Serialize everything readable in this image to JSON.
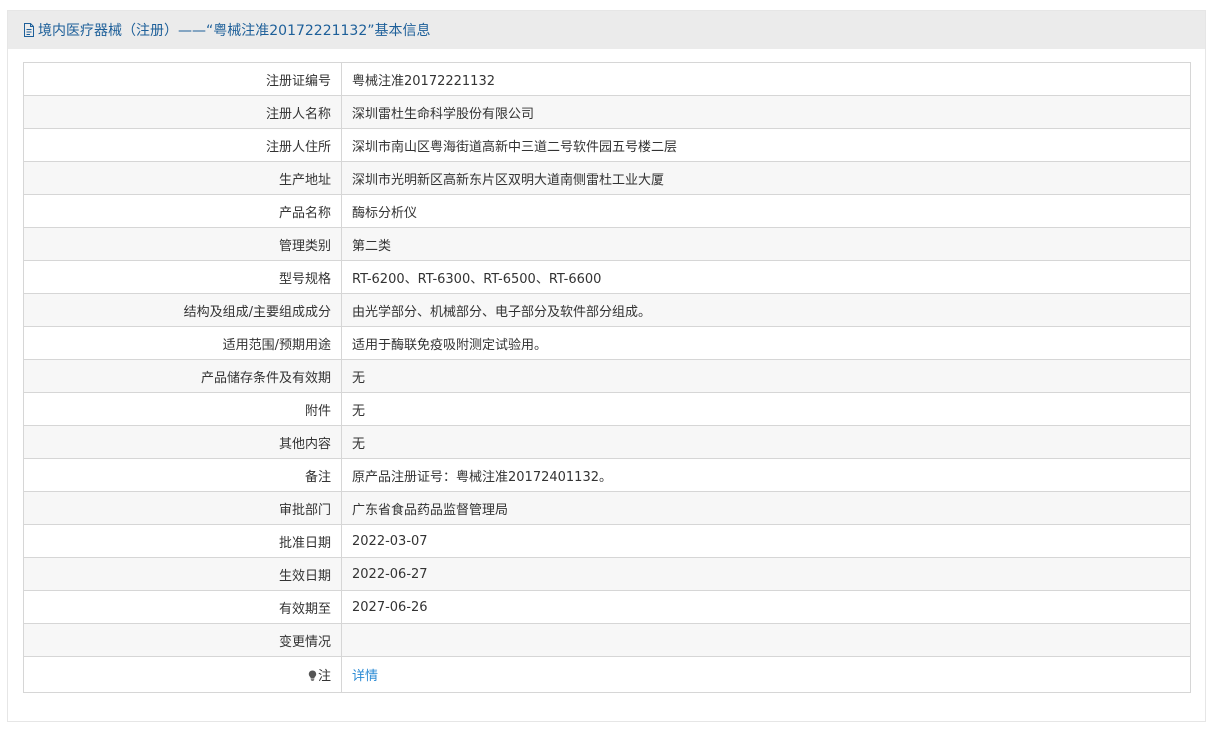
{
  "header": {
    "icon": "document-icon",
    "title": "境内医疗器械（注册）——“粤械注准20172221132”基本信息",
    "title_color": "#1d5f99",
    "background": "#ebebeb"
  },
  "rows": [
    {
      "label": "注册证编号",
      "value": "粤械注准20172221132"
    },
    {
      "label": "注册人名称",
      "value": "深圳雷杜生命科学股份有限公司"
    },
    {
      "label": "注册人住所",
      "value": "深圳市南山区粤海街道高新中三道二号软件园五号楼二层"
    },
    {
      "label": "生产地址",
      "value": "深圳市光明新区高新东片区双明大道南侧雷杜工业大厦"
    },
    {
      "label": "产品名称",
      "value": "酶标分析仪"
    },
    {
      "label": "管理类别",
      "value": "第二类"
    },
    {
      "label": "型号规格",
      "value": "RT-6200、RT-6300、RT-6500、RT-6600"
    },
    {
      "label": "结构及组成/主要组成成分",
      "value": "由光学部分、机械部分、电子部分及软件部分组成。"
    },
    {
      "label": "适用范围/预期用途",
      "value": "适用于酶联免疫吸附测定试验用。"
    },
    {
      "label": "产品储存条件及有效期",
      "value": "无"
    },
    {
      "label": "附件",
      "value": "无"
    },
    {
      "label": "其他内容",
      "value": "无"
    },
    {
      "label": "备注",
      "value": "原产品注册证号：粤械注准20172401132。"
    },
    {
      "label": "审批部门",
      "value": "广东省食品药品监督管理局"
    },
    {
      "label": "批准日期",
      "value": "2022-03-07"
    },
    {
      "label": "生效日期",
      "value": "2022-06-27"
    },
    {
      "label": "有效期至",
      "value": "2027-06-26"
    },
    {
      "label": "变更情况",
      "value": ""
    }
  ],
  "note": {
    "icon": "lightbulb-icon",
    "label": "注",
    "link_text": "详情",
    "link_color": "#2a8ad4"
  }
}
